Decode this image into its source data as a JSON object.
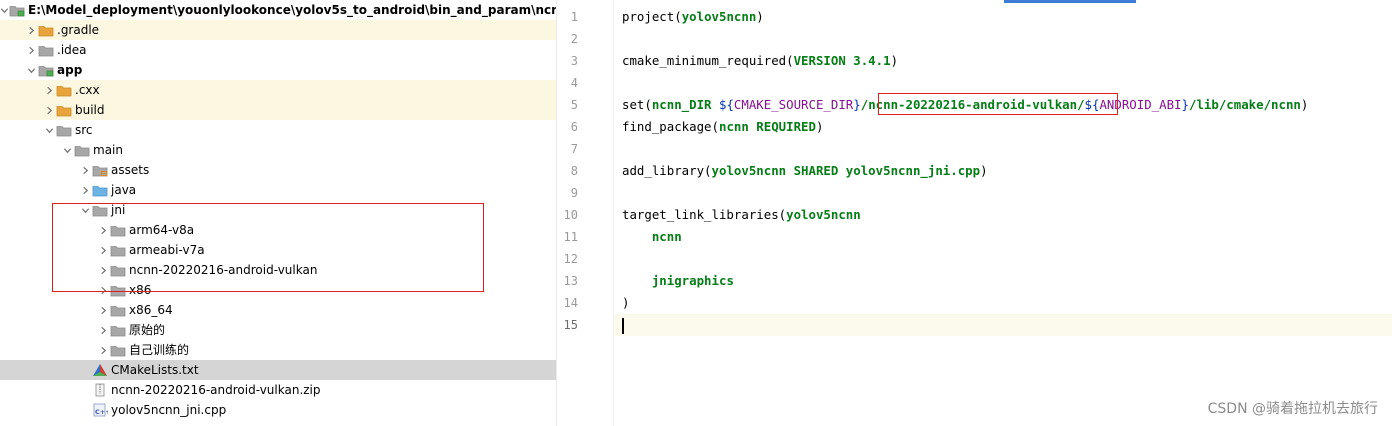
{
  "tree": {
    "items": [
      {
        "label": "E:\\Model_deployment\\youonlylookonce\\yolov5s_to_android\\bin_and_param\\ncnn-a",
        "icon": "module-folder-icon",
        "expanded": true,
        "bold": true
      },
      {
        "label": ".gradle",
        "icon": "orange-folder-icon",
        "expanded": false
      },
      {
        "label": ".idea",
        "icon": "folder-icon",
        "expanded": false
      },
      {
        "label": "app",
        "icon": "module-folder-icon",
        "expanded": true,
        "bold": true
      },
      {
        "label": ".cxx",
        "icon": "orange-folder-icon",
        "expanded": false
      },
      {
        "label": "build",
        "icon": "orange-folder-icon",
        "expanded": false
      },
      {
        "label": "src",
        "icon": "folder-icon",
        "expanded": true
      },
      {
        "label": "main",
        "icon": "folder-icon",
        "expanded": true
      },
      {
        "label": "assets",
        "icon": "resource-folder-icon",
        "expanded": false
      },
      {
        "label": "java",
        "icon": "blue-folder-icon",
        "expanded": false
      },
      {
        "label": "jni",
        "icon": "folder-icon",
        "expanded": true
      },
      {
        "label": "arm64-v8a",
        "icon": "folder-icon",
        "expanded": false
      },
      {
        "label": "armeabi-v7a",
        "icon": "folder-icon",
        "expanded": false
      },
      {
        "label": "ncnn-20220216-android-vulkan",
        "icon": "folder-icon",
        "expanded": false
      },
      {
        "label": "x86",
        "icon": "folder-icon",
        "expanded": false
      },
      {
        "label": "x86_64",
        "icon": "folder-icon",
        "expanded": false
      },
      {
        "label": "原始的",
        "icon": "folder-icon",
        "expanded": false
      },
      {
        "label": "自己训练的",
        "icon": "folder-icon",
        "expanded": false
      },
      {
        "label": "CMakeLists.txt",
        "icon": "cmake-file-icon",
        "selected": true
      },
      {
        "label": "ncnn-20220216-android-vulkan.zip",
        "icon": "zip-file-icon"
      },
      {
        "label": "yolov5ncnn_jni.cpp",
        "icon": "cpp-file-icon"
      }
    ]
  },
  "editor": {
    "lines": [
      {
        "num": "1",
        "tokens": [
          [
            "project(",
            "kw"
          ],
          [
            "yolov5ncnn",
            "arg"
          ],
          [
            ")",
            "kw"
          ]
        ]
      },
      {
        "num": "2",
        "tokens": []
      },
      {
        "num": "3",
        "tokens": [
          [
            "cmake_minimum_required(",
            "kw"
          ],
          [
            "VERSION 3.4.1",
            "arg"
          ],
          [
            ")",
            "kw"
          ]
        ]
      },
      {
        "num": "4",
        "tokens": []
      },
      {
        "num": "5",
        "tokens": [
          [
            "set(",
            "kw"
          ],
          [
            "ncnn_DIR ",
            "arg"
          ],
          [
            "${",
            "brace"
          ],
          [
            "CMAKE_SOURCE_DIR",
            "var"
          ],
          [
            "}",
            "brace"
          ],
          [
            "/ncnn-20220216-android-vulkan/",
            "arg"
          ],
          [
            "${",
            "brace"
          ],
          [
            "ANDROID_ABI",
            "var"
          ],
          [
            "}",
            "brace"
          ],
          [
            "/lib/cmake/ncnn",
            "arg"
          ],
          [
            ")",
            "kw"
          ]
        ]
      },
      {
        "num": "6",
        "tokens": [
          [
            "find_package(",
            "kw"
          ],
          [
            "ncnn REQUIRED",
            "arg"
          ],
          [
            ")",
            "kw"
          ]
        ]
      },
      {
        "num": "7",
        "tokens": []
      },
      {
        "num": "8",
        "tokens": [
          [
            "add_library(",
            "kw"
          ],
          [
            "yolov5ncnn SHARED yolov5ncnn_jni.cpp",
            "arg"
          ],
          [
            ")",
            "kw"
          ]
        ]
      },
      {
        "num": "9",
        "tokens": []
      },
      {
        "num": "10",
        "tokens": [
          [
            "target_link_libraries(",
            "kw"
          ],
          [
            "yolov5ncnn",
            "arg"
          ]
        ]
      },
      {
        "num": "11",
        "tokens": [
          [
            "    ",
            "kw"
          ],
          [
            "ncnn",
            "arg"
          ]
        ]
      },
      {
        "num": "12",
        "tokens": []
      },
      {
        "num": "13",
        "tokens": [
          [
            "    ",
            "kw"
          ],
          [
            "jnigraphics",
            "arg"
          ]
        ]
      },
      {
        "num": "14",
        "tokens": [
          [
            ")",
            "kw"
          ]
        ]
      },
      {
        "num": "15",
        "tokens": [],
        "current": true
      }
    ]
  },
  "colors": {
    "accent": "#3d7bd6",
    "annotation_red": "#e02020",
    "argument_green": "#067d17",
    "variable_purple": "#871094",
    "brace_blue": "#0033b3"
  },
  "watermark": "CSDN @骑着拖拉机去旅行"
}
